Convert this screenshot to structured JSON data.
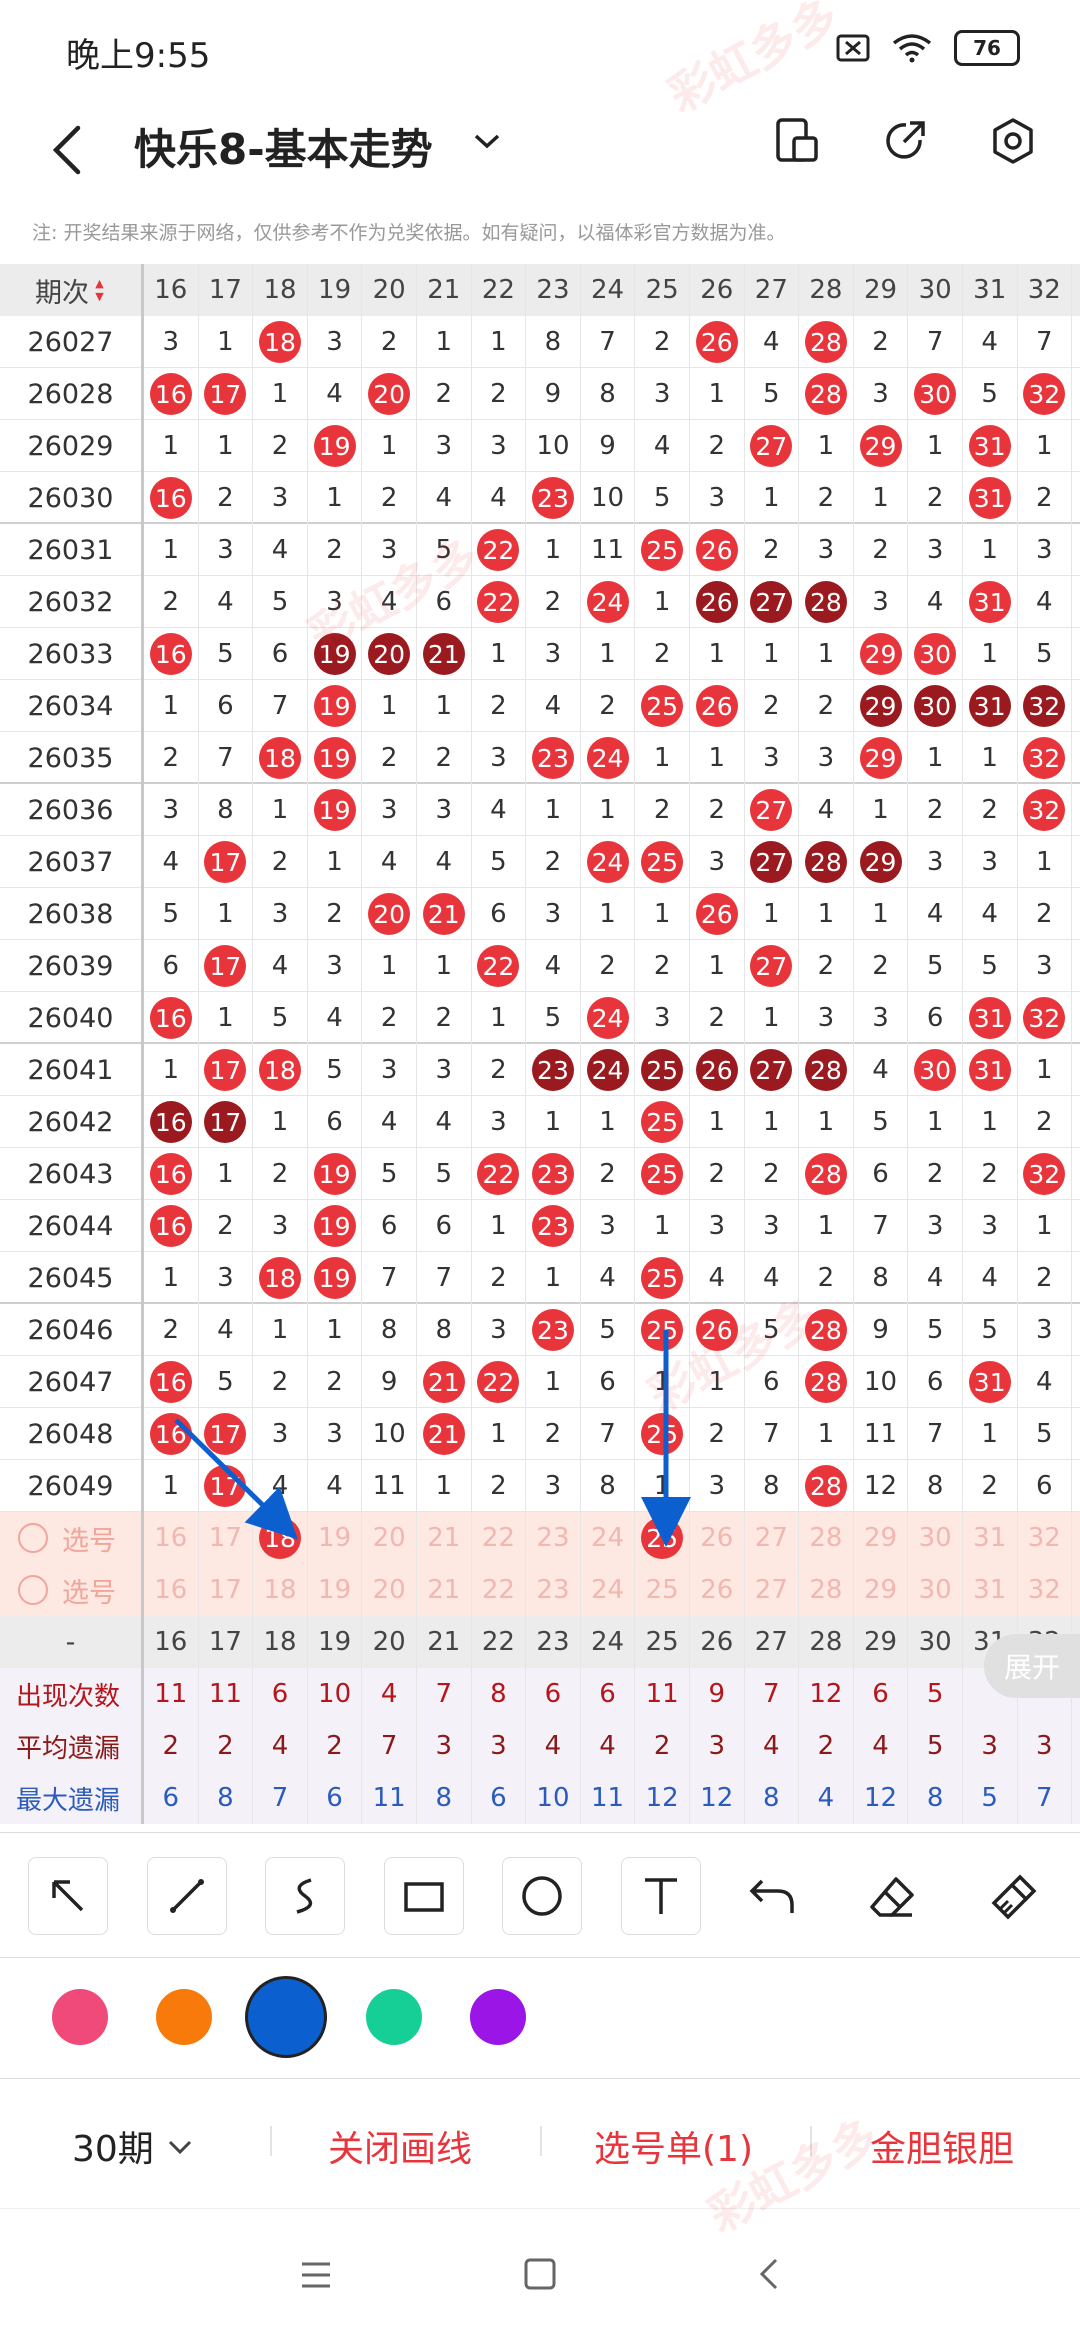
{
  "status": {
    "time": "晚上9:55",
    "battery": "76"
  },
  "header": {
    "title": "快乐8-基本走势"
  },
  "notice": "注: 开奖结果来源于网络，仅供参考不作为兑奖依据。如有疑问，以福体彩官方数据为准。",
  "table": {
    "period_label": "期次",
    "columns": [
      "16",
      "17",
      "18",
      "19",
      "20",
      "21",
      "22",
      "23",
      "24",
      "25",
      "26",
      "27",
      "28",
      "29",
      "30",
      "31",
      "32"
    ],
    "rows": [
      {
        "p": "26027",
        "v": [
          "3",
          "1",
          "18",
          "3",
          "2",
          "1",
          "1",
          "8",
          "7",
          "2",
          "26",
          "4",
          "28",
          "2",
          "7",
          "4",
          "7"
        ],
        "h": [
          0,
          0,
          1,
          0,
          0,
          0,
          0,
          0,
          0,
          0,
          1,
          0,
          1,
          0,
          0,
          0,
          0
        ]
      },
      {
        "p": "26028",
        "v": [
          "16",
          "17",
          "1",
          "4",
          "20",
          "2",
          "2",
          "9",
          "8",
          "3",
          "1",
          "5",
          "28",
          "3",
          "30",
          "5",
          "32"
        ],
        "h": [
          1,
          1,
          0,
          0,
          1,
          0,
          0,
          0,
          0,
          0,
          0,
          0,
          1,
          0,
          1,
          0,
          1
        ]
      },
      {
        "p": "26029",
        "v": [
          "1",
          "1",
          "2",
          "19",
          "1",
          "3",
          "3",
          "10",
          "9",
          "4",
          "2",
          "27",
          "1",
          "29",
          "1",
          "31",
          "1"
        ],
        "h": [
          0,
          0,
          0,
          1,
          0,
          0,
          0,
          0,
          0,
          0,
          0,
          1,
          0,
          1,
          0,
          1,
          0
        ]
      },
      {
        "p": "26030",
        "v": [
          "16",
          "2",
          "3",
          "1",
          "2",
          "4",
          "4",
          "23",
          "10",
          "5",
          "3",
          "1",
          "2",
          "1",
          "2",
          "31",
          "2"
        ],
        "h": [
          1,
          0,
          0,
          0,
          0,
          0,
          0,
          1,
          0,
          0,
          0,
          0,
          0,
          0,
          0,
          1,
          0
        ]
      },
      {
        "p": "26031",
        "v": [
          "1",
          "3",
          "4",
          "2",
          "3",
          "5",
          "22",
          "1",
          "11",
          "25",
          "26",
          "2",
          "3",
          "2",
          "3",
          "1",
          "3"
        ],
        "h": [
          0,
          0,
          0,
          0,
          0,
          0,
          1,
          0,
          0,
          1,
          1,
          0,
          0,
          0,
          0,
          0,
          0
        ]
      },
      {
        "p": "26032",
        "v": [
          "2",
          "4",
          "5",
          "3",
          "4",
          "6",
          "22",
          "2",
          "24",
          "1",
          "26",
          "27",
          "28",
          "3",
          "4",
          "31",
          "4"
        ],
        "h": [
          0,
          0,
          0,
          0,
          0,
          0,
          1,
          0,
          1,
          0,
          2,
          2,
          2,
          0,
          0,
          1,
          0
        ]
      },
      {
        "p": "26033",
        "v": [
          "16",
          "5",
          "6",
          "19",
          "20",
          "21",
          "1",
          "3",
          "1",
          "2",
          "1",
          "1",
          "1",
          "29",
          "30",
          "1",
          "5"
        ],
        "h": [
          1,
          0,
          0,
          2,
          2,
          2,
          0,
          0,
          0,
          0,
          0,
          0,
          0,
          1,
          1,
          0,
          0
        ]
      },
      {
        "p": "26034",
        "v": [
          "1",
          "6",
          "7",
          "19",
          "1",
          "1",
          "2",
          "4",
          "2",
          "25",
          "26",
          "2",
          "2",
          "29",
          "30",
          "31",
          "32"
        ],
        "h": [
          0,
          0,
          0,
          1,
          0,
          0,
          0,
          0,
          0,
          1,
          1,
          0,
          0,
          2,
          2,
          2,
          2
        ]
      },
      {
        "p": "26035",
        "v": [
          "2",
          "7",
          "18",
          "19",
          "2",
          "2",
          "3",
          "23",
          "24",
          "1",
          "1",
          "3",
          "3",
          "29",
          "1",
          "1",
          "32"
        ],
        "h": [
          0,
          0,
          1,
          1,
          0,
          0,
          0,
          1,
          1,
          0,
          0,
          0,
          0,
          1,
          0,
          0,
          1
        ]
      },
      {
        "p": "26036",
        "v": [
          "3",
          "8",
          "1",
          "19",
          "3",
          "3",
          "4",
          "1",
          "1",
          "2",
          "2",
          "27",
          "4",
          "1",
          "2",
          "2",
          "32"
        ],
        "h": [
          0,
          0,
          0,
          1,
          0,
          0,
          0,
          0,
          0,
          0,
          0,
          1,
          0,
          0,
          0,
          0,
          1
        ]
      },
      {
        "p": "26037",
        "v": [
          "4",
          "17",
          "2",
          "1",
          "4",
          "4",
          "5",
          "2",
          "24",
          "25",
          "3",
          "27",
          "28",
          "29",
          "3",
          "3",
          "1"
        ],
        "h": [
          0,
          1,
          0,
          0,
          0,
          0,
          0,
          0,
          1,
          1,
          0,
          2,
          2,
          2,
          0,
          0,
          0
        ]
      },
      {
        "p": "26038",
        "v": [
          "5",
          "1",
          "3",
          "2",
          "20",
          "21",
          "6",
          "3",
          "1",
          "1",
          "26",
          "1",
          "1",
          "1",
          "4",
          "4",
          "2"
        ],
        "h": [
          0,
          0,
          0,
          0,
          1,
          1,
          0,
          0,
          0,
          0,
          1,
          0,
          0,
          0,
          0,
          0,
          0
        ]
      },
      {
        "p": "26039",
        "v": [
          "6",
          "17",
          "4",
          "3",
          "1",
          "1",
          "22",
          "4",
          "2",
          "2",
          "1",
          "27",
          "2",
          "2",
          "5",
          "5",
          "3"
        ],
        "h": [
          0,
          1,
          0,
          0,
          0,
          0,
          1,
          0,
          0,
          0,
          0,
          1,
          0,
          0,
          0,
          0,
          0
        ]
      },
      {
        "p": "26040",
        "v": [
          "16",
          "1",
          "5",
          "4",
          "2",
          "2",
          "1",
          "5",
          "24",
          "3",
          "2",
          "1",
          "3",
          "3",
          "6",
          "31",
          "32"
        ],
        "h": [
          1,
          0,
          0,
          0,
          0,
          0,
          0,
          0,
          1,
          0,
          0,
          0,
          0,
          0,
          0,
          1,
          1
        ]
      },
      {
        "p": "26041",
        "v": [
          "1",
          "17",
          "18",
          "5",
          "3",
          "3",
          "2",
          "23",
          "24",
          "25",
          "26",
          "27",
          "28",
          "4",
          "30",
          "31",
          "1"
        ],
        "h": [
          0,
          1,
          1,
          0,
          0,
          0,
          0,
          2,
          2,
          2,
          2,
          2,
          2,
          0,
          1,
          1,
          0
        ]
      },
      {
        "p": "26042",
        "v": [
          "16",
          "17",
          "1",
          "6",
          "4",
          "4",
          "3",
          "1",
          "1",
          "25",
          "1",
          "1",
          "1",
          "5",
          "1",
          "1",
          "2"
        ],
        "h": [
          2,
          2,
          0,
          0,
          0,
          0,
          0,
          0,
          0,
          1,
          0,
          0,
          0,
          0,
          0,
          0,
          0
        ]
      },
      {
        "p": "26043",
        "v": [
          "16",
          "1",
          "2",
          "19",
          "5",
          "5",
          "22",
          "23",
          "2",
          "25",
          "2",
          "2",
          "28",
          "6",
          "2",
          "2",
          "32"
        ],
        "h": [
          1,
          0,
          0,
          1,
          0,
          0,
          1,
          1,
          0,
          1,
          0,
          0,
          1,
          0,
          0,
          0,
          1
        ]
      },
      {
        "p": "26044",
        "v": [
          "16",
          "2",
          "3",
          "19",
          "6",
          "6",
          "1",
          "23",
          "3",
          "1",
          "3",
          "3",
          "1",
          "7",
          "3",
          "3",
          "1"
        ],
        "h": [
          1,
          0,
          0,
          1,
          0,
          0,
          0,
          1,
          0,
          0,
          0,
          0,
          0,
          0,
          0,
          0,
          0
        ]
      },
      {
        "p": "26045",
        "v": [
          "1",
          "3",
          "18",
          "19",
          "7",
          "7",
          "2",
          "1",
          "4",
          "25",
          "4",
          "4",
          "2",
          "8",
          "4",
          "4",
          "2"
        ],
        "h": [
          0,
          0,
          1,
          1,
          0,
          0,
          0,
          0,
          0,
          1,
          0,
          0,
          0,
          0,
          0,
          0,
          0
        ]
      },
      {
        "p": "26046",
        "v": [
          "2",
          "4",
          "1",
          "1",
          "8",
          "8",
          "3",
          "23",
          "5",
          "25",
          "26",
          "5",
          "28",
          "9",
          "5",
          "5",
          "3"
        ],
        "h": [
          0,
          0,
          0,
          0,
          0,
          0,
          0,
          1,
          0,
          1,
          1,
          0,
          1,
          0,
          0,
          0,
          0
        ]
      },
      {
        "p": "26047",
        "v": [
          "16",
          "5",
          "2",
          "2",
          "9",
          "21",
          "22",
          "1",
          "6",
          "1",
          "1",
          "6",
          "28",
          "10",
          "6",
          "31",
          "4"
        ],
        "h": [
          1,
          0,
          0,
          0,
          0,
          1,
          1,
          0,
          0,
          0,
          0,
          0,
          1,
          0,
          0,
          1,
          0
        ]
      },
      {
        "p": "26048",
        "v": [
          "16",
          "17",
          "3",
          "3",
          "10",
          "21",
          "1",
          "2",
          "7",
          "25",
          "2",
          "7",
          "1",
          "11",
          "7",
          "1",
          "5"
        ],
        "h": [
          1,
          1,
          0,
          0,
          0,
          1,
          0,
          0,
          0,
          1,
          0,
          0,
          0,
          0,
          0,
          0,
          0
        ]
      },
      {
        "p": "26049",
        "v": [
          "1",
          "17",
          "4",
          "4",
          "11",
          "1",
          "2",
          "3",
          "8",
          "1",
          "3",
          "8",
          "28",
          "12",
          "8",
          "2",
          "6"
        ],
        "h": [
          0,
          1,
          0,
          0,
          0,
          0,
          0,
          0,
          0,
          0,
          0,
          0,
          1,
          0,
          0,
          0,
          0
        ]
      }
    ],
    "select_label": "选号",
    "select1_selected": [
      2,
      9
    ],
    "footer_label": "-",
    "stats": [
      {
        "label": "出现次数",
        "color": "#b5161c",
        "v": [
          "11",
          "11",
          "6",
          "10",
          "4",
          "7",
          "8",
          "6",
          "6",
          "11",
          "9",
          "7",
          "12",
          "6",
          "5",
          "",
          ""
        ]
      },
      {
        "label": "平均遗漏",
        "color": "#8a1a1a",
        "v": [
          "2",
          "2",
          "4",
          "2",
          "7",
          "3",
          "3",
          "4",
          "4",
          "2",
          "3",
          "4",
          "2",
          "4",
          "5",
          "3",
          "3"
        ]
      },
      {
        "label": "最大遗漏",
        "color": "#2b5bbd",
        "v": [
          "6",
          "8",
          "7",
          "6",
          "11",
          "8",
          "6",
          "10",
          "11",
          "12",
          "12",
          "8",
          "4",
          "12",
          "8",
          "5",
          "7"
        ]
      }
    ],
    "expand_label": "展开"
  },
  "tools": [
    "arrow-tool",
    "line-tool",
    "curve-tool",
    "rect-tool",
    "circle-tool",
    "text-tool",
    "undo-tool",
    "eraser-tool",
    "clear-tool"
  ],
  "colors": [
    "#ef4a7a",
    "#f77a0a",
    "#0b5fcf",
    "#16cf96",
    "#9b16e6"
  ],
  "bottom": {
    "period": "30期",
    "close_draw": "关闭画线",
    "select_list": "选号单(1)",
    "gold_silver": "金胆银胆"
  },
  "watermark": "彩虹多多"
}
